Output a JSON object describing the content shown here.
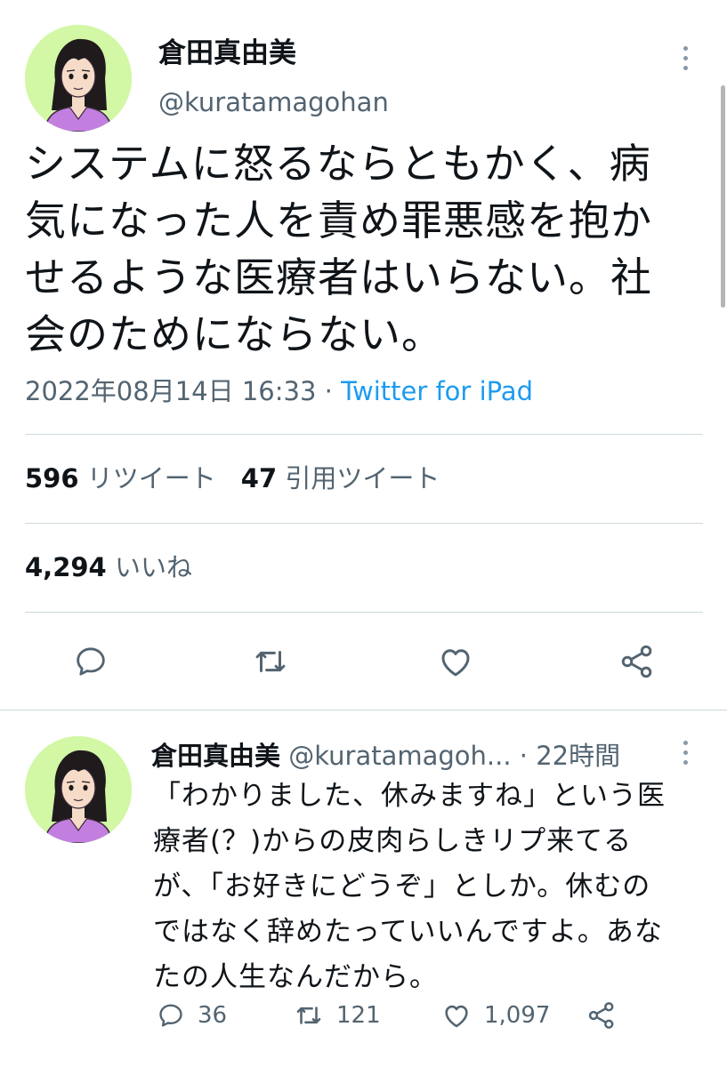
{
  "main_tweet": {
    "author_name": "倉田真由美",
    "handle": "@kuratamagohan",
    "text_lines": [
      "システムに怒るならともかく、病",
      "気になった人を責め罪悪感を抱か",
      "せるような医療者はいらない。社",
      "会のためにならない。"
    ],
    "timestamp": "2022年08月14日 16:33",
    "separator": " · ",
    "source": "Twitter for iPad",
    "retweet_count": "596",
    "retweet_label": "リツイート",
    "quote_count": "47",
    "quote_label": "引用ツイート",
    "like_count": "4,294",
    "like_label": "いいね"
  },
  "reply_tweet": {
    "author_name": "倉田真由美",
    "handle": "@kuratamagoh...",
    "time_ago": "· 22時間",
    "text_lines": [
      "「わかりました、休みますね」という医",
      "療者(？)からの皮肉らしきリプ来てる",
      "が、「お好きにどうぞ」としか。休むの",
      "ではなく辞めたっていいんですよ。あな",
      "たの人生なんだから。"
    ],
    "reply_count": "36",
    "retweet_count": "121",
    "like_count": "1,097"
  },
  "icons": {
    "reply": "speech-bubble-icon",
    "retweet": "retweet-arrows-icon",
    "like": "heart-icon",
    "share": "share-icon",
    "more": "more-vertical-icon"
  },
  "colors": {
    "text": "#0f1419",
    "secondary": "#536471",
    "link": "#1d9bf0",
    "divider": "#cfd9de",
    "avatar_bg": "#d2f7a5",
    "avatar_shirt": "#c27fe0"
  }
}
